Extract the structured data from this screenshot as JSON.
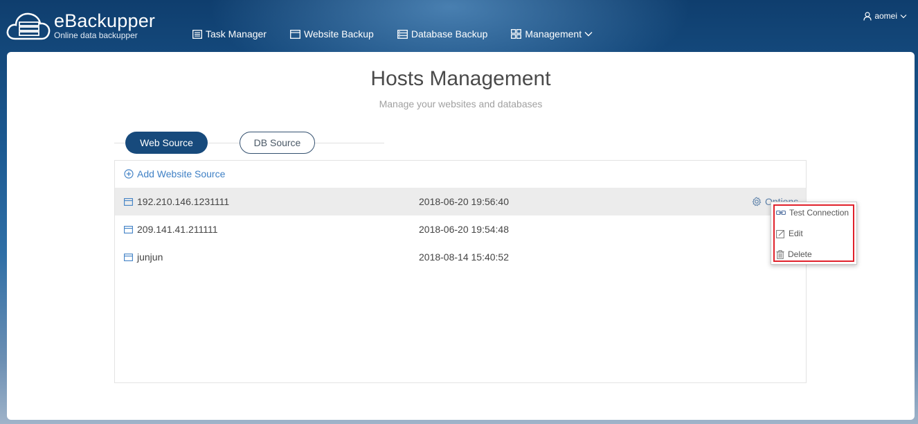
{
  "app": {
    "title": "eBackupper",
    "subtitle": "Online data backupper"
  },
  "nav": {
    "items": [
      {
        "label": "Task Manager",
        "icon": "list-icon"
      },
      {
        "label": "Website Backup",
        "icon": "window-icon"
      },
      {
        "label": "Database Backup",
        "icon": "database-icon"
      },
      {
        "label": "Management",
        "icon": "grid-icon"
      }
    ]
  },
  "user": {
    "name": "aomei"
  },
  "page": {
    "title": "Hosts Management",
    "subtitle": "Manage your websites and databases"
  },
  "tabs": {
    "web": "Web Source",
    "db": "DB Source",
    "active": "web"
  },
  "table": {
    "add_label": "Add Website Source",
    "options_label": "Options",
    "rows": [
      {
        "host": "192.210.146.1231111",
        "time": "2018-06-20 19:56:40",
        "selected": true
      },
      {
        "host": "209.141.41.211111",
        "time": "2018-06-20 19:54:48",
        "selected": false
      },
      {
        "host": "junjun",
        "time": "2018-08-14 15:40:52",
        "selected": false
      }
    ]
  },
  "dropdown": {
    "items": [
      {
        "label": "Test Connection",
        "icon": "link-icon"
      },
      {
        "label": "Edit",
        "icon": "edit-icon"
      },
      {
        "label": "Delete",
        "icon": "trash-icon"
      }
    ]
  },
  "colors": {
    "accent": "#174a7c",
    "link": "#3f80c5",
    "highlight": "#e0202a"
  }
}
